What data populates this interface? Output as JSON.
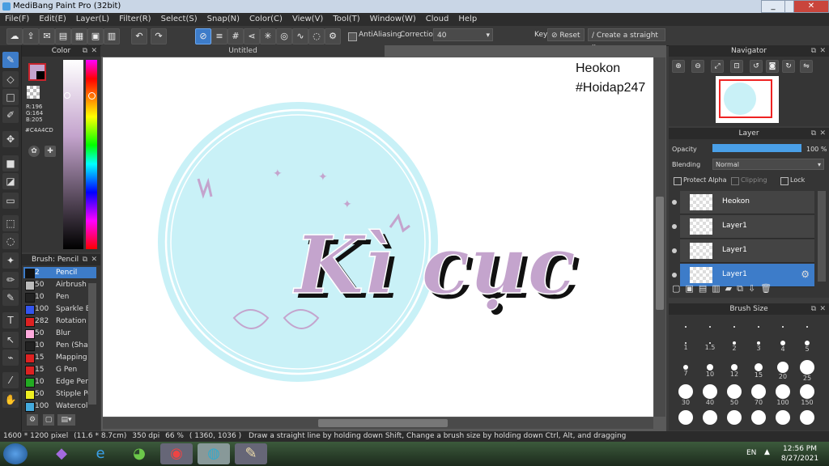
{
  "window": {
    "title": "MediBang Paint Pro (32bit)",
    "minimize": "_",
    "maximize": "□",
    "close": "✕"
  },
  "menu": [
    "File(F)",
    "Edit(E)",
    "Layer(L)",
    "Filter(R)",
    "Select(S)",
    "Snap(N)",
    "Color(C)",
    "View(V)",
    "Tool(T)",
    "Window(W)",
    "Cloud",
    "Help"
  ],
  "toolbar": {
    "antialiasing": "AntiAliasing",
    "correction_label": "Correction",
    "correction_value": "40",
    "key_label": "Key",
    "reset_label": "Reset",
    "straight_line_label": "Create a straight line"
  },
  "color_panel": {
    "title": "Color",
    "r": "R:196",
    "g": "G:164",
    "b": "B:205",
    "hex": "#C4A4CD",
    "primary_color": "#c4a4cd"
  },
  "brush_panel": {
    "title": "Brush: Pencil",
    "items": [
      {
        "size": "2",
        "name": "Pencil",
        "color": "#111111",
        "selected": true
      },
      {
        "size": "50",
        "name": "Airbrush",
        "color": "#bbbbbb"
      },
      {
        "size": "10",
        "name": "Pen",
        "color": "#222222"
      },
      {
        "size": "100",
        "name": "Sparkle B",
        "color": "#3355ee"
      },
      {
        "size": "282",
        "name": "Rotation",
        "color": "#dd2222"
      },
      {
        "size": "50",
        "name": "Blur",
        "color": "#ffaadd"
      },
      {
        "size": "10",
        "name": "Pen (Sha",
        "color": "#222222"
      },
      {
        "size": "15",
        "name": "Mapping",
        "color": "#dd2222"
      },
      {
        "size": "15",
        "name": "G Pen",
        "color": "#dd2222"
      },
      {
        "size": "10",
        "name": "Edge Pen",
        "color": "#22aa22"
      },
      {
        "size": "50",
        "name": "Stipple Pe",
        "color": "#eeee22"
      },
      {
        "size": "100",
        "name": "Watercol",
        "color": "#44aadd"
      }
    ]
  },
  "canvas": {
    "tab": "Untitled",
    "watermark_line1": "Heokon",
    "watermark_line2": "#Hoidap247",
    "artwork_text": "Kì cục"
  },
  "navigator": {
    "title": "Navigator"
  },
  "layer_panel": {
    "title": "Layer",
    "opacity_label": "Opacity",
    "opacity_value": "100 %",
    "opacity_fraction": 1.0,
    "blending_label": "Blending",
    "blending_value": "Normal",
    "protect_alpha": "Protect Alpha",
    "clipping": "Clipping",
    "lock": "Lock",
    "layers": [
      {
        "name": "Heokon"
      },
      {
        "name": "Layer1"
      },
      {
        "name": "Layer1"
      },
      {
        "name": "Layer1",
        "selected": true
      }
    ]
  },
  "brush_size_panel": {
    "title": "Brush Size",
    "sizes": [
      "1",
      "1.5",
      "2",
      "3",
      "4",
      "5",
      "7",
      "10",
      "12",
      "15",
      "20",
      "25",
      "30",
      "40",
      "50",
      "70",
      "100",
      "150"
    ]
  },
  "status": {
    "pixels": "1600 * 1200 pixel",
    "cm": "(11.6 * 8.7cm)",
    "dpi": "350 dpi",
    "zoom": "66 %",
    "coords": "( 1360, 1036 )",
    "hint": "Draw a straight line by holding down Shift, Change a brush size by holding down Ctrl, Alt, and dragging"
  },
  "taskbar": {
    "lang": "EN",
    "time": "12:56 PM",
    "date": "8/27/2021"
  }
}
